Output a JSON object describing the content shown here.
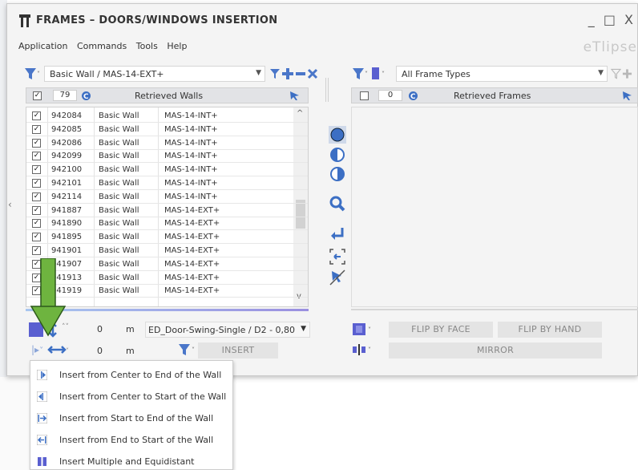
{
  "window": {
    "title": "FRAMES – DOORS/WINDOWS INSERTION",
    "controls": "_ □ X",
    "brand": "eTlipse"
  },
  "menu": [
    "Application",
    "Commands",
    "Tools",
    "Help"
  ],
  "left_panel": {
    "filter_value": "Basic Wall / MAS-14-EXT+",
    "count": "79",
    "header": "Retrieved Walls",
    "rows": [
      {
        "id": "942084",
        "type": "Basic Wall",
        "name": "MAS-14-INT+",
        "checked": true
      },
      {
        "id": "942085",
        "type": "Basic Wall",
        "name": "MAS-14-INT+",
        "checked": true
      },
      {
        "id": "942086",
        "type": "Basic Wall",
        "name": "MAS-14-INT+",
        "checked": true
      },
      {
        "id": "942099",
        "type": "Basic Wall",
        "name": "MAS-14-INT+",
        "checked": true
      },
      {
        "id": "942100",
        "type": "Basic Wall",
        "name": "MAS-14-INT+",
        "checked": true
      },
      {
        "id": "942101",
        "type": "Basic Wall",
        "name": "MAS-14-INT+",
        "checked": true
      },
      {
        "id": "942114",
        "type": "Basic Wall",
        "name": "MAS-14-INT+",
        "checked": true
      },
      {
        "id": "941887",
        "type": "Basic Wall",
        "name": "MAS-14-EXT+",
        "checked": true
      },
      {
        "id": "941890",
        "type": "Basic Wall",
        "name": "MAS-14-EXT+",
        "checked": true
      },
      {
        "id": "941895",
        "type": "Basic Wall",
        "name": "MAS-14-EXT+",
        "checked": true
      },
      {
        "id": "941901",
        "type": "Basic Wall",
        "name": "MAS-14-EXT+",
        "checked": true
      },
      {
        "id": "941907",
        "type": "Basic Wall",
        "name": "MAS-14-EXT+",
        "checked": true
      },
      {
        "id": "941913",
        "type": "Basic Wall",
        "name": "MAS-14-EXT+",
        "checked": true
      },
      {
        "id": "941919",
        "type": "Basic Wall",
        "name": "MAS-14-EXT+",
        "checked": true
      }
    ],
    "offset_value_1": "0",
    "offset_unit_1": "m",
    "family_value": "ED_Door-Swing-Single / D2 - 0,80",
    "offset_value_2": "0",
    "offset_unit_2": "m",
    "insert_label": "INSERT"
  },
  "right_panel": {
    "filter_value": "All Frame Types",
    "count": "0",
    "header": "Retrieved Frames",
    "flip_face_label": "FLIP BY FACE",
    "flip_hand_label": "FLIP BY HAND",
    "mirror_label": "MIRROR"
  },
  "insert_menu": [
    "Insert from Center to End of the Wall",
    "Insert from Center to Start of the Wall",
    "Insert from Start to End of the Wall",
    "Insert from End to Start of the Wall",
    "Insert Multiple and Equidistant"
  ],
  "colors": {
    "accent_blue": "#3c6fc4",
    "filter_blue": "#4a76c9",
    "green_arrow": "#6eb43f",
    "header_gray": "#e2e3e6"
  }
}
